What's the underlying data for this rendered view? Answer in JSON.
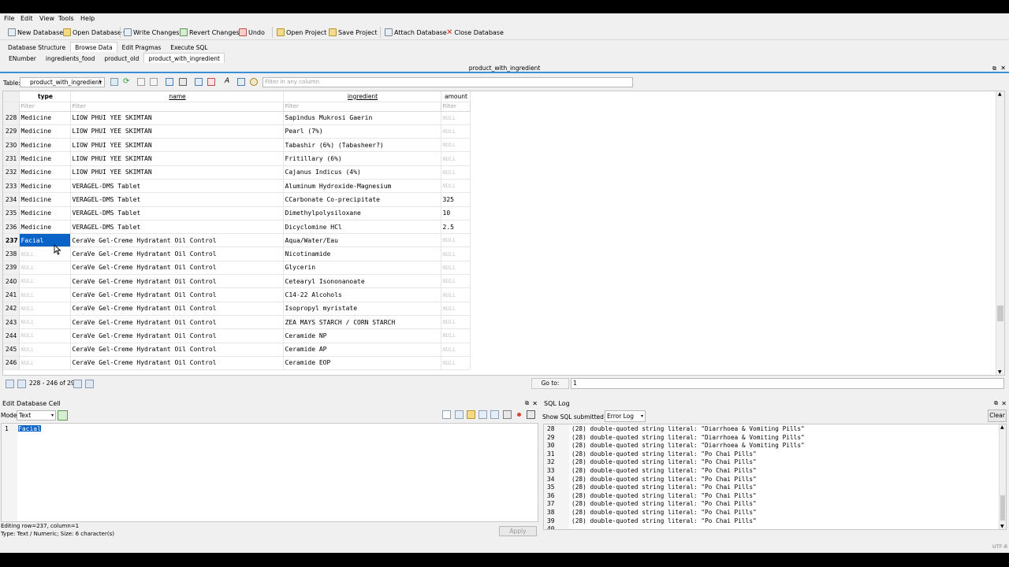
{
  "menu": [
    "File",
    "Edit",
    "View",
    "Tools",
    "Help"
  ],
  "toolbar": {
    "new_db": "New Database",
    "open_db": "Open Database",
    "write": "Write Changes",
    "revert": "Revert Changes",
    "undo": "Undo",
    "open_project": "Open Project",
    "save_project": "Save Project",
    "attach": "Attach Database",
    "close": "Close Database"
  },
  "main_tabs": [
    "Database Structure",
    "Browse Data",
    "Edit Pragmas",
    "Execute SQL"
  ],
  "table_tabs": [
    "ENumber",
    "ingredients_food",
    "product_old",
    "product_with_ingredient"
  ],
  "panel_title": "product_with_ingredient",
  "filterbar": {
    "table_label": "Table:",
    "table_value": "product_with_ingredient",
    "filter_placeholder": "Filter in any column"
  },
  "grid": {
    "columns": [
      "type",
      "name",
      "ingredient",
      "amount"
    ],
    "filter_placeholder": "Filter",
    "null_text": "NULL",
    "rows": [
      {
        "n": "228",
        "type": "Medicine",
        "name": "LIOW PHUI YEE SKIMTAN",
        "ingredient": "Sapindus  Mukrosi Gaerin",
        "amount": null
      },
      {
        "n": "229",
        "type": "Medicine",
        "name": "LIOW PHUI YEE SKIMTAN",
        "ingredient": "Pearl (7%)",
        "amount": null
      },
      {
        "n": "230",
        "type": "Medicine",
        "name": "LIOW PHUI YEE SKIMTAN",
        "ingredient": "Tabashir (6%) (Tabasheer?)",
        "amount": null
      },
      {
        "n": "231",
        "type": "Medicine",
        "name": "LIOW PHUI YEE SKIMTAN",
        "ingredient": "Fritillary (6%)",
        "amount": null
      },
      {
        "n": "232",
        "type": "Medicine",
        "name": "LIOW PHUI YEE SKIMTAN",
        "ingredient": "Cajanus Indicus (4%)",
        "amount": null
      },
      {
        "n": "233",
        "type": "Medicine",
        "name": "VERAGEL-DMS Tablet",
        "ingredient": "Aluminum Hydroxide-Magnesium",
        "amount": null
      },
      {
        "n": "234",
        "type": "Medicine",
        "name": "VERAGEL-DMS Tablet",
        "ingredient": "CCarbonate Co-precipitate",
        "amount": "325"
      },
      {
        "n": "235",
        "type": "Medicine",
        "name": "VERAGEL-DMS Tablet",
        "ingredient": "Dimethylpolysiloxane",
        "amount": "10"
      },
      {
        "n": "236",
        "type": "Medicine",
        "name": "VERAGEL-DMS Tablet",
        "ingredient": "Dicyclomine HCl",
        "amount": "2.5"
      },
      {
        "n": "237",
        "type": "Facial",
        "name": "CeraVe Gel-Creme Hydratant Oil Control",
        "ingredient": "Aqua/Water/Eau",
        "amount": null,
        "selected": true
      },
      {
        "n": "238",
        "type": null,
        "name": "CeraVe Gel-Creme Hydratant Oil Control",
        "ingredient": "Nicotinamide",
        "amount": null
      },
      {
        "n": "239",
        "type": null,
        "name": "CeraVe Gel-Creme Hydratant Oil Control",
        "ingredient": "Glycerin",
        "amount": null
      },
      {
        "n": "240",
        "type": null,
        "name": "CeraVe Gel-Creme Hydratant Oil Control",
        "ingredient": "Cetearyl Isononanoate",
        "amount": null
      },
      {
        "n": "241",
        "type": null,
        "name": "CeraVe Gel-Creme Hydratant Oil Control",
        "ingredient": "C14-22 Alcohols",
        "amount": null
      },
      {
        "n": "242",
        "type": null,
        "name": "CeraVe Gel-Creme Hydratant Oil Control",
        "ingredient": "Isopropyl myristate",
        "amount": null
      },
      {
        "n": "243",
        "type": null,
        "name": "CeraVe Gel-Creme Hydratant Oil Control",
        "ingredient": "ZEA MAYS STARCH / CORN STARCH",
        "amount": null
      },
      {
        "n": "244",
        "type": null,
        "name": "CeraVe Gel-Creme Hydratant Oil Control",
        "ingredient": "Ceramide NP",
        "amount": null
      },
      {
        "n": "245",
        "type": null,
        "name": "CeraVe Gel-Creme Hydratant Oil Control",
        "ingredient": "Ceramide AP",
        "amount": null
      },
      {
        "n": "246",
        "type": null,
        "name": "CeraVe Gel-Creme Hydratant Oil Control",
        "ingredient": "Ceramide EOP",
        "amount": null
      }
    ]
  },
  "nav": {
    "range": "228 - 246 of 293",
    "goto_label": "Go to:",
    "goto_value": "1"
  },
  "edit_cell": {
    "title": "Edit Database Cell",
    "mode_label": "Mode:",
    "mode_value": "Text",
    "line_no": "1",
    "content": "Facial",
    "status1": "Editing row=237, column=1",
    "status2": "Type: Text / Numeric; Size: 6 character(s)",
    "apply": "Apply"
  },
  "sql_log": {
    "title": "SQL Log",
    "show_label": "Show SQL submitted by",
    "source": "Error Log",
    "clear": "Clear",
    "lines": [
      {
        "n": "28",
        "t": "(28) double-quoted string literal: \"Diarrhoea & Vomiting Pills\""
      },
      {
        "n": "29",
        "t": "(28) double-quoted string literal: \"Diarrhoea & Vomiting Pills\""
      },
      {
        "n": "30",
        "t": "(28) double-quoted string literal: \"Diarrhoea & Vomiting Pills\""
      },
      {
        "n": "31",
        "t": "(28) double-quoted string literal: \"Po Chai Pills\""
      },
      {
        "n": "32",
        "t": "(28) double-quoted string literal: \"Po Chai Pills\""
      },
      {
        "n": "33",
        "t": "(28) double-quoted string literal: \"Po Chai Pills\""
      },
      {
        "n": "34",
        "t": "(28) double-quoted string literal: \"Po Chai Pills\""
      },
      {
        "n": "35",
        "t": "(28) double-quoted string literal: \"Po Chai Pills\""
      },
      {
        "n": "36",
        "t": "(28) double-quoted string literal: \"Po Chai Pills\""
      },
      {
        "n": "37",
        "t": "(28) double-quoted string literal: \"Po Chai Pills\""
      },
      {
        "n": "38",
        "t": "(28) double-quoted string literal: \"Po Chai Pills\""
      },
      {
        "n": "39",
        "t": "(28) double-quoted string literal: \"Po Chai Pills\""
      },
      {
        "n": "40",
        "t": ""
      }
    ]
  },
  "encoding": "UTF-8",
  "colors": {
    "selection": "#0a64c8",
    "accent": "#3a8fd8"
  }
}
